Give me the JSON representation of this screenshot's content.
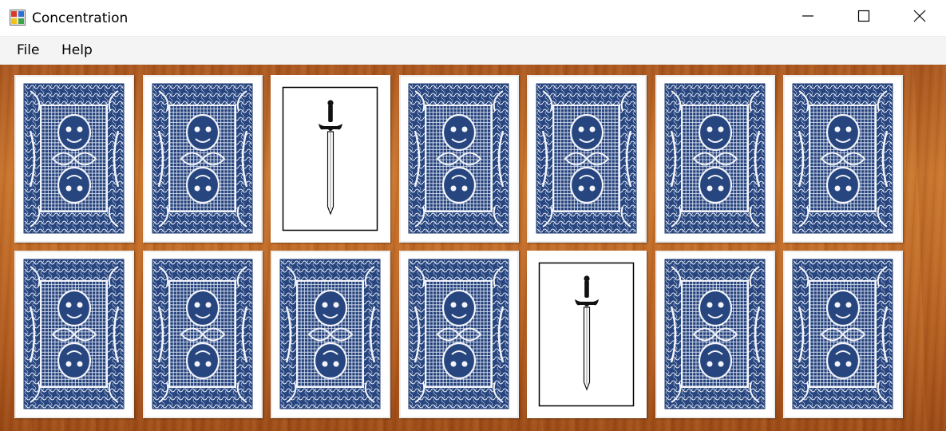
{
  "window": {
    "title": "Concentration",
    "icon": "app-icon",
    "controls": [
      "minimize-icon",
      "maximize-icon",
      "close-icon"
    ]
  },
  "menu": {
    "items": [
      {
        "label": "File"
      },
      {
        "label": "Help"
      }
    ]
  },
  "board": {
    "rows": 2,
    "columns": 7,
    "card_back_color": "#1f3f7a",
    "table_color": "#c06926",
    "cards": [
      {
        "face_up": false
      },
      {
        "face_up": false
      },
      {
        "face_up": true,
        "image": "sword-icon"
      },
      {
        "face_up": false
      },
      {
        "face_up": false
      },
      {
        "face_up": false
      },
      {
        "face_up": false
      },
      {
        "face_up": false
      },
      {
        "face_up": false
      },
      {
        "face_up": false
      },
      {
        "face_up": false
      },
      {
        "face_up": true,
        "image": "sword-icon"
      },
      {
        "face_up": false
      },
      {
        "face_up": false
      }
    ]
  }
}
